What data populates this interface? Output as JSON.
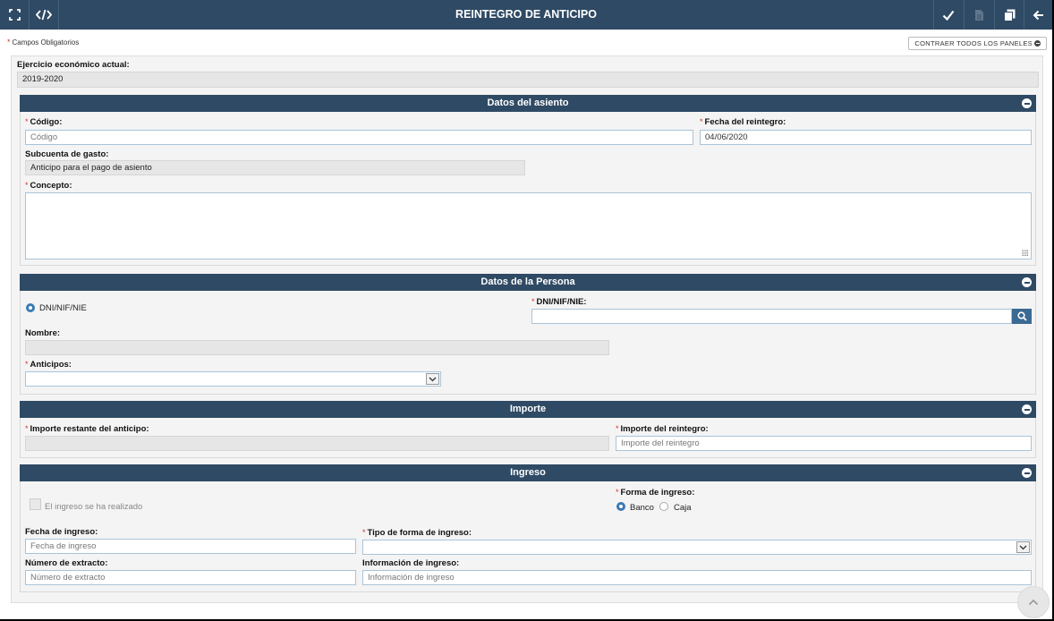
{
  "header": {
    "title": "REINTEGRO DE ANTICIPO"
  },
  "toolbar": {
    "required_note": "Campos Obligatorios",
    "collapse_all": "CONTRAER TODOS LOS PANELES"
  },
  "fiscal_year": {
    "label": "Ejercicio económico actual:",
    "value": "2019-2020"
  },
  "panels": {
    "asiento": {
      "title": "Datos del asiento",
      "codigo_label": "Código:",
      "codigo_placeholder": "Código",
      "fecha_label": "Fecha del reintegro:",
      "fecha_value": "04/06/2020",
      "subcuenta_label": "Subcuenta de gasto:",
      "subcuenta_value": "Anticipo para el pago de asiento",
      "concepto_label": "Concepto:"
    },
    "persona": {
      "title": "Datos de la Persona",
      "radio_label": "DNI/NIF/NIE",
      "dni_label": "DNI/NIF/NIE:",
      "nombre_label": "Nombre:",
      "anticipos_label": "Anticipos:"
    },
    "importe": {
      "title": "Importe",
      "restante_label": "Importe restante del anticipo:",
      "reintegro_label": "Importe del reintegro:",
      "reintegro_placeholder": "Importe del reintegro"
    },
    "ingreso": {
      "title": "Ingreso",
      "checkbox_label": "El ingreso se ha realizado",
      "forma_label": "Forma de ingreso:",
      "forma_options": [
        "Banco",
        "Caja"
      ],
      "forma_selected": "Banco",
      "fecha_label": "Fecha de ingreso:",
      "fecha_placeholder": "Fecha de ingreso",
      "tipo_label": "Tipo de forma de ingreso:",
      "extracto_label": "Número de extracto:",
      "extracto_placeholder": "Número de extracto",
      "info_label": "Información de ingreso:",
      "info_placeholder": "Información de ingreso"
    }
  },
  "colors": {
    "header_bg": "#2f4a64",
    "accent": "#3b7ab3",
    "required": "#d9342b"
  }
}
